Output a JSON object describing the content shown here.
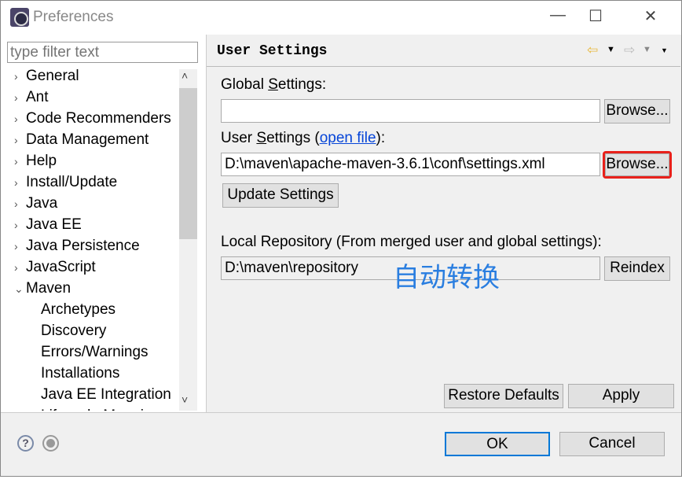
{
  "window": {
    "title": "Preferences",
    "minimize": "—",
    "maximize": "☐",
    "close": "✕"
  },
  "filter": {
    "placeholder": "type filter text"
  },
  "tree": [
    {
      "label": "General",
      "expanded": false,
      "level": 0
    },
    {
      "label": "Ant",
      "expanded": false,
      "level": 0
    },
    {
      "label": "Code Recommenders",
      "expanded": false,
      "level": 0
    },
    {
      "label": "Data Management",
      "expanded": false,
      "level": 0
    },
    {
      "label": "Help",
      "expanded": false,
      "level": 0
    },
    {
      "label": "Install/Update",
      "expanded": false,
      "level": 0
    },
    {
      "label": "Java",
      "expanded": false,
      "level": 0
    },
    {
      "label": "Java EE",
      "expanded": false,
      "level": 0
    },
    {
      "label": "Java Persistence",
      "expanded": false,
      "level": 0
    },
    {
      "label": "JavaScript",
      "expanded": false,
      "level": 0
    },
    {
      "label": "Maven",
      "expanded": true,
      "level": 0
    },
    {
      "label": "Archetypes",
      "level": 1
    },
    {
      "label": "Discovery",
      "level": 1
    },
    {
      "label": "Errors/Warnings",
      "level": 1
    },
    {
      "label": "Installations",
      "level": 1
    },
    {
      "label": "Java EE Integration",
      "level": 1
    },
    {
      "label": "Lifecycle Mappings",
      "level": 1
    }
  ],
  "page": {
    "title": "User Settings",
    "global_label_pre": "Global ",
    "global_label_u": "S",
    "global_label_post": "ettings:",
    "global_value": "",
    "browse": "Browse...",
    "user_label_pre": "User ",
    "user_label_u": "S",
    "user_label_mid": "ettings (",
    "open_file": "open file",
    "user_label_post": "):",
    "user_value": "D:\\maven\\apache-maven-3.6.1\\conf\\settings.xml",
    "update": "Update Settings",
    "local_label": "Local Repository (From merged user and global settings):",
    "local_value": "D:\\maven\\repository",
    "reindex": "Reindex",
    "overlay_text": "自动转换",
    "restore": "Restore Defaults",
    "apply": "Apply"
  },
  "footer": {
    "ok": "OK",
    "cancel": "Cancel"
  },
  "colors": {
    "highlight": "#e8201a",
    "overlay": "#2a7ee0",
    "link": "#0645d8"
  }
}
